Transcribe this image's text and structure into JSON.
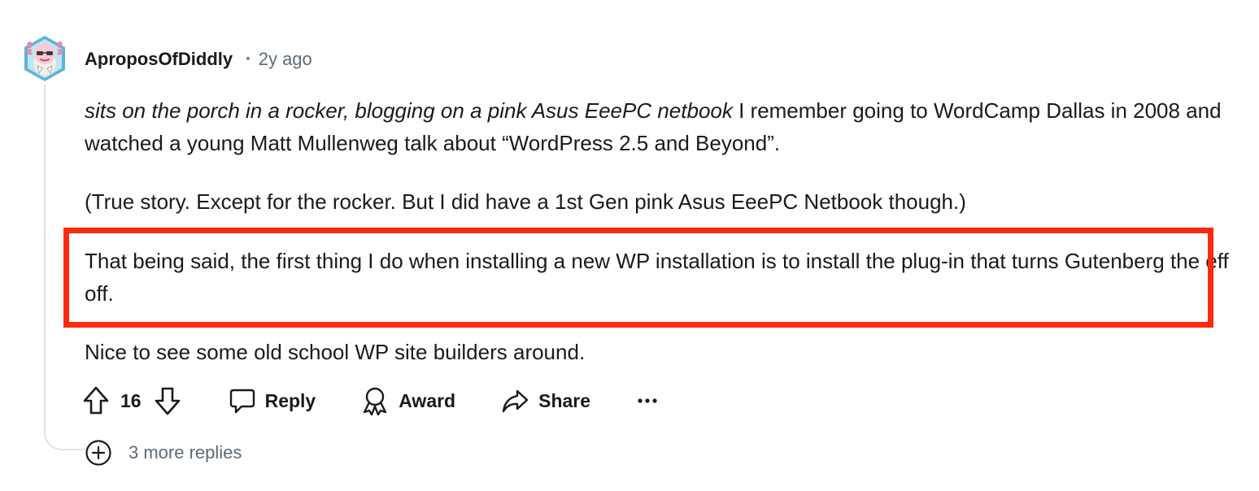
{
  "comment": {
    "author": "AproposOfDiddly",
    "separator": "•",
    "age": "2y ago",
    "avatar_icon": "axolotl-avatar-icon",
    "paragraphs": {
      "p1_italic": "sits on the porch in a rocker, blogging on a pink Asus EeePC netbook",
      "p1_rest": " I remember going to WordCamp Dallas in 2008 and watched a young Matt Mullenweg talk about “WordPress 2.5 and Beyond”.",
      "p2": "(True story. Except for the rocker. But I did have a 1st Gen pink Asus EeePC Netbook though.)",
      "p3": "That being said, the first thing I do when installing a new WP installation is to install the plug-in that turns Gutenberg the eff off.",
      "p4": "Nice to see some old school WP site builders around."
    },
    "highlight_color": "#ff2a0c"
  },
  "actions": {
    "upvote_icon": "upvote-arrow-icon",
    "vote_count": "16",
    "downvote_icon": "downvote-arrow-icon",
    "reply_label": "Reply",
    "award_label": "Award",
    "share_label": "Share",
    "more_icon": "ellipsis-icon"
  },
  "more_replies": {
    "label": "3 more replies",
    "icon": "plus-circle-icon"
  }
}
